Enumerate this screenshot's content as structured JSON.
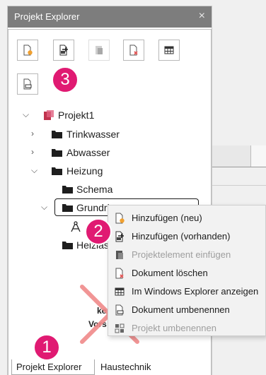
{
  "window": {
    "title": "Projekt Explorer",
    "close_glyph": "×"
  },
  "toolbar": {
    "buttons": [
      {
        "name": "new-document",
        "icon": "document-add-icon",
        "enabled": true
      },
      {
        "name": "add-existing",
        "icon": "document-import-icon",
        "enabled": true
      },
      {
        "name": "paste-element",
        "icon": "paste-icon",
        "enabled": false
      },
      {
        "name": "delete-document",
        "icon": "document-delete-icon",
        "enabled": true
      },
      {
        "name": "show-in-explorer",
        "icon": "grid-icon",
        "enabled": true
      },
      {
        "name": "rename-document",
        "icon": "document-rename-icon",
        "enabled": true
      }
    ]
  },
  "tree": {
    "root": "Projekt1",
    "items": [
      {
        "label": "Trinkwasser",
        "expanded": false
      },
      {
        "label": "Abwasser",
        "expanded": false
      },
      {
        "label": "Heizung",
        "expanded": true
      },
      {
        "label": "Schema"
      },
      {
        "label": "Grundri",
        "expanded": true,
        "selected": true
      },
      {
        "label": "Heizlas"
      }
    ]
  },
  "context_menu": {
    "items": [
      {
        "label": "Hinzufügen (neu)",
        "icon": "document-add-icon",
        "enabled": true
      },
      {
        "label": "Hinzufügen (vorhanden)",
        "icon": "document-import-icon",
        "enabled": true
      },
      {
        "label": "Projektelement einfügen",
        "icon": "paste-icon",
        "enabled": false
      },
      {
        "label": "Dokument löschen",
        "icon": "document-delete-icon",
        "enabled": true
      },
      {
        "label": "Im Windows Explorer anzeigen",
        "icon": "grid-icon",
        "enabled": true
      },
      {
        "label": "Dokument umbenennen",
        "icon": "document-rename-icon",
        "enabled": true
      },
      {
        "label": "Projekt umbenennen",
        "icon": "project-rename-icon",
        "enabled": false
      }
    ]
  },
  "obscured_text": {
    "line1": "ke",
    "line2": "Vors"
  },
  "badges": {
    "one": "1",
    "two": "2",
    "three": "3"
  },
  "tabs": [
    {
      "label": "Projekt Explorer",
      "active": true
    },
    {
      "label": "Haustechnik",
      "active": false
    }
  ],
  "colors": {
    "accent_badge": "#e01a72",
    "titlebar": "#7d7d7d",
    "project_icon": "#c0334d",
    "add_orange": "#f0a030",
    "delete_red": "#e05050",
    "strike_red": "#f08a8a"
  }
}
